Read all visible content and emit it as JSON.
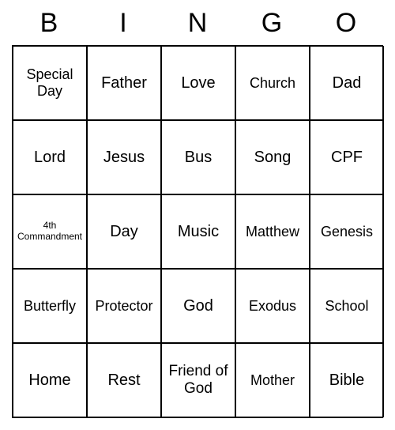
{
  "header": [
    "B",
    "I",
    "N",
    "G",
    "O"
  ],
  "cells": [
    [
      {
        "text": "Special Day",
        "size": "sm"
      },
      {
        "text": "Father",
        "size": ""
      },
      {
        "text": "Love",
        "size": ""
      },
      {
        "text": "Church",
        "size": "sm"
      },
      {
        "text": "Dad",
        "size": ""
      }
    ],
    [
      {
        "text": "Lord",
        "size": ""
      },
      {
        "text": "Jesus",
        "size": ""
      },
      {
        "text": "Bus",
        "size": ""
      },
      {
        "text": "Song",
        "size": ""
      },
      {
        "text": "CPF",
        "size": ""
      }
    ],
    [
      {
        "text": "4th Commandment",
        "size": "xs"
      },
      {
        "text": "Day",
        "size": ""
      },
      {
        "text": "Music",
        "size": ""
      },
      {
        "text": "Matthew",
        "size": "sm"
      },
      {
        "text": "Genesis",
        "size": "sm"
      }
    ],
    [
      {
        "text": "Butterfly",
        "size": "sm"
      },
      {
        "text": "Protector",
        "size": "sm"
      },
      {
        "text": "God",
        "size": ""
      },
      {
        "text": "Exodus",
        "size": "sm"
      },
      {
        "text": "School",
        "size": "sm"
      }
    ],
    [
      {
        "text": "Home",
        "size": ""
      },
      {
        "text": "Rest",
        "size": ""
      },
      {
        "text": "Friend of God",
        "size": "md"
      },
      {
        "text": "Mother",
        "size": "sm"
      },
      {
        "text": "Bible",
        "size": ""
      }
    ]
  ]
}
